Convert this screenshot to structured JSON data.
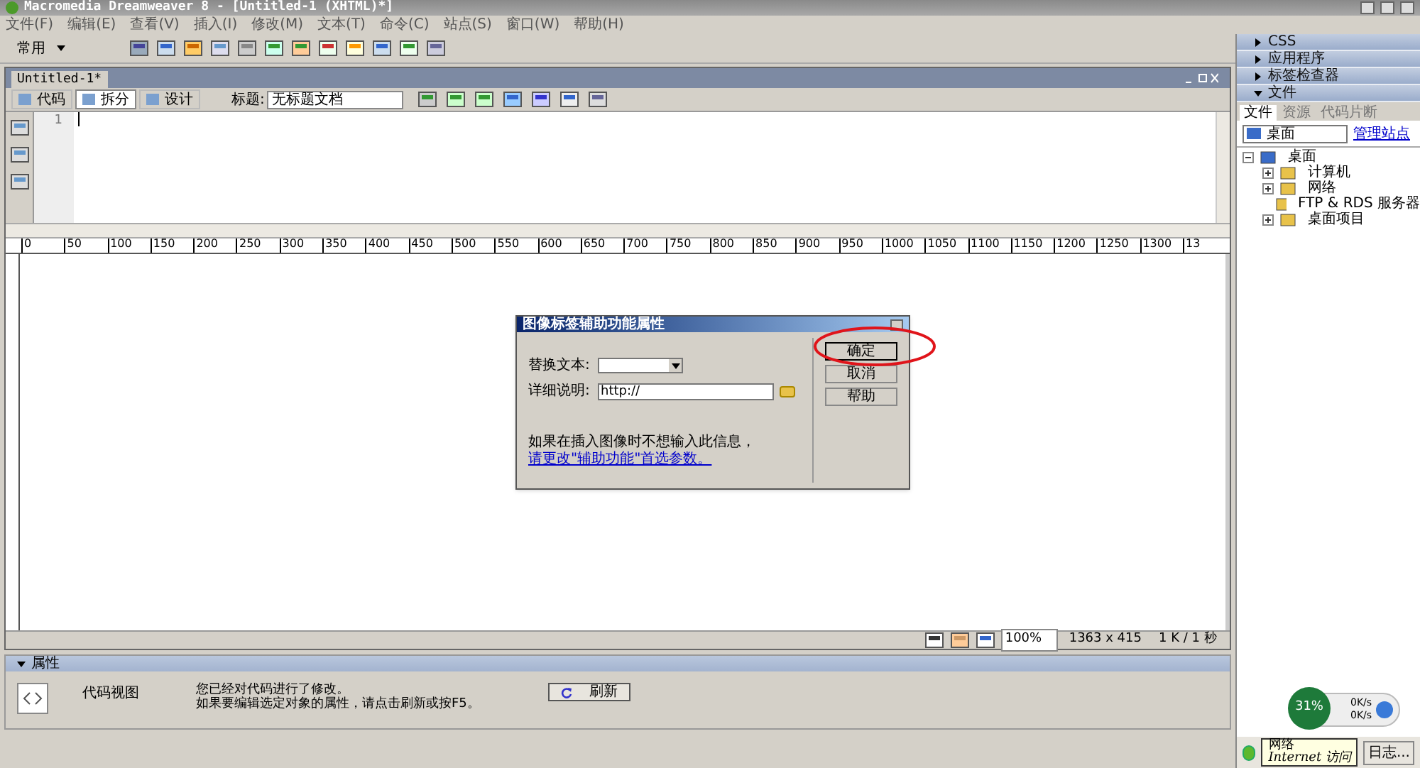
{
  "window": {
    "title": "Macromedia Dreamweaver 8 - [Untitled-1 (XHTML)*]"
  },
  "menu": [
    "文件(F)",
    "编辑(E)",
    "查看(V)",
    "插入(I)",
    "修改(M)",
    "文本(T)",
    "命令(C)",
    "站点(S)",
    "窗口(W)",
    "帮助(H)"
  ],
  "insert_bar": {
    "category": "常用"
  },
  "document": {
    "tab": "Untitled-1*",
    "views": [
      {
        "label": "代码",
        "selected": false
      },
      {
        "label": "拆分",
        "selected": true
      },
      {
        "label": "设计",
        "selected": false
      }
    ],
    "title_label": "标题:",
    "title_value": "无标题文档",
    "line_numbers": [
      "1"
    ],
    "ruler": [
      "0",
      "50",
      "100",
      "150",
      "200",
      "250",
      "300",
      "350",
      "400",
      "450",
      "500",
      "550",
      "600",
      "650",
      "700",
      "750",
      "800",
      "850",
      "900",
      "950",
      "1000",
      "1050",
      "1100",
      "1150",
      "1200",
      "1250",
      "1300",
      "13"
    ],
    "status": {
      "zoom": "100%",
      "size": "1363 x 415",
      "speed": "1 K / 1 秒"
    }
  },
  "dialog": {
    "title": "图像标签辅助功能属性",
    "alt_label": "替换文本:",
    "desc_label": "详细说明:",
    "desc_value": "http://",
    "note": "如果在插入图像时不想输入此信息，",
    "note_link": "请更改\"辅助功能\"首选参数。",
    "buttons": [
      "确定",
      "取消",
      "帮助"
    ]
  },
  "properties": {
    "header": "属性",
    "mode": "代码视图",
    "message": [
      "您已经对代码进行了修改。",
      "如果要编辑选定对象的属性，请点击刷新或按F5。"
    ],
    "refresh": "刷新"
  },
  "panels": [
    {
      "title": "CSS",
      "expanded": false
    },
    {
      "title": "应用程序",
      "expanded": false
    },
    {
      "title": "标签检查器",
      "expanded": false
    },
    {
      "title": "文件",
      "expanded": true
    }
  ],
  "files": {
    "tabs": [
      {
        "label": "文件",
        "selected": true
      },
      {
        "label": "资源",
        "selected": false
      },
      {
        "label": "代码片断",
        "selected": false
      }
    ],
    "location": "桌面",
    "manage": "管理站点",
    "tree": {
      "label": "桌面",
      "expanded": true,
      "children": [
        {
          "label": "计算机",
          "expanded": false
        },
        {
          "label": "网络",
          "expanded": false
        },
        {
          "label": "FTP & RDS 服务器"
        },
        {
          "label": "桌面项目",
          "expanded": false
        }
      ]
    },
    "log": "日志..."
  },
  "tooltip": [
    "网络",
    "Internet 访问"
  ],
  "net_widget": {
    "percent": "31%",
    "up": "0K/s",
    "down": "0K/s"
  }
}
